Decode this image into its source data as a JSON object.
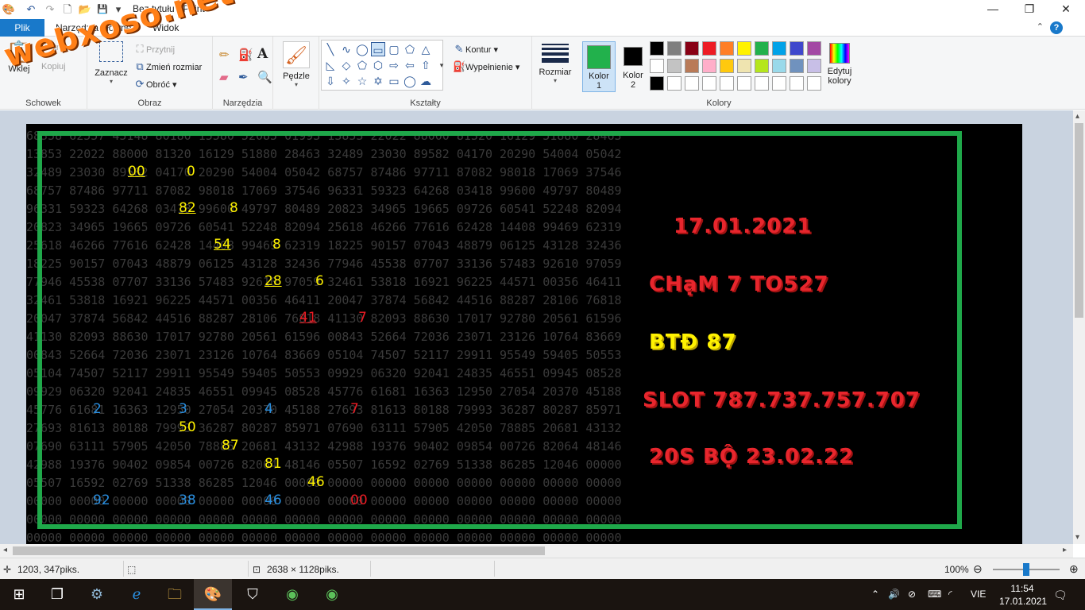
{
  "window": {
    "title": "Bez tytułu - Paint",
    "controls": {
      "minimize": "—",
      "maximize": "❐",
      "close": "✕"
    }
  },
  "quick_access": {
    "undo_icon": "↶",
    "redo_icon": "↷",
    "new_icon": "🗋",
    "save_icon": "💾",
    "dropdown": "▾"
  },
  "menu": {
    "file": "Plik",
    "tabs": [
      "Narzędzia główne",
      "Widok"
    ],
    "help": "?",
    "collapse": "⌃"
  },
  "ribbon": {
    "clipboard": {
      "label": "Schowek",
      "paste": "Wklej",
      "cut": "Wytnij",
      "copy": "Kopiuj"
    },
    "image": {
      "label": "Obraz",
      "select": "Zaznacz",
      "crop": "Przytnij",
      "resize": "Zmień rozmiar",
      "rotate": "Obróć"
    },
    "tools": {
      "label": "Narzędzia"
    },
    "brushes": {
      "label": "Pędzle"
    },
    "shapes": {
      "label": "Kształty",
      "outline": "Kontur",
      "fill": "Wypełnienie"
    },
    "size": {
      "label": "Rozmiar"
    },
    "colors": {
      "label": "Kolory",
      "color1": "Kolor 1",
      "color1_value": "#22b14c",
      "color2": "Kolor 2",
      "color2_value": "#000000",
      "edit": "Edytuj kolory",
      "palette": [
        "#000000",
        "#7f7f7f",
        "#880015",
        "#ed1c24",
        "#ff7f27",
        "#fff200",
        "#22b14c",
        "#00a2e8",
        "#3f48cc",
        "#a349a4",
        "#ffffff",
        "#c3c3c3",
        "#b97a57",
        "#ffaec9",
        "#ffc90e",
        "#efe4b0",
        "#b5e61d",
        "#99d9ea",
        "#7092be",
        "#c8bfe7",
        "#000000",
        "#ffffff",
        "#ffffff",
        "#ffffff",
        "#ffffff",
        "#ffffff",
        "#ffffff",
        "#ffffff",
        "#ffffff",
        "#ffffff"
      ]
    }
  },
  "watermark": "webxoso.net",
  "canvas": {
    "bg_rows": [
      "68358 62557 45148 80180 15580 52085 01993 13853 22022 88000 81320 16129 51880 28463",
      "13853 22022 88000 81320 16129 51880 28463 32489 23030 89582 04170 20290 54004 05042",
      "32489 23030 89582 04170 20290 54004 05042 68757 87486 97711 87082 98018 17069 37546",
      "68757 87486 97711 87082 98018 17069 37546 96331 59323 64268 03418 99600 49797 80489",
      "96331 59323 64268 03418 99600 49797 80489 20823 34965 19665 09726 60541 52248 82094",
      "20823 34965 19665 09726 60541 52248 82094 25618 46266 77616 62428 14408 99469 62319",
      "25618 46266 77616 62428 14408 99469 62319 18225 90157 07043 48879 06125 43128 32436",
      "18225 90157 07043 48879 06125 43128 32436 77946 45538 07707 33136 57483 92610 97059",
      "77946 45538 07707 33136 57483 92610 97059 32461 53818 16921 96225 44571 00356 46411",
      "32461 53818 16921 96225 44571 00356 46411 20047 37874 56842 44516 88287 28106 76818",
      "20047 37874 56842 44516 88287 28106 76818 41130 82093 88630 17017 92780 20561 61596",
      "41130 82093 88630 17017 92780 20561 61596 00843 52664 72036 23071 23126 10764 83669",
      "00843 52664 72036 23071 23126 10764 83669 05104 74507 52117 29911 95549 59405 50553",
      "05104 74507 52117 29911 95549 59405 50553 09929 06320 92041 24835 46551 09945 08528",
      "09929 06320 92041 24835 46551 09945 08528 45776 61681 16363 12950 27054 20370 45188",
      "45776 61681 16363 12950 27054 20370 45188 27693 81613 80188 79993 36287 80287 85971",
      "27693 81613 80188 79993 36287 80287 85971 07690 63111 57905 42050 78885 20681 43132",
      "07690 63111 57905 42050 78885 20681 43132 42988 19376 90402 09854 00726 82064 48146",
      "42988 19376 90402 09854 00726 82064 48146 05507 16592 02769 51338 86285 12046 00000",
      "05507 16592 02769 51338 86285 12046 00000 00000 00000 00000 00000 00000 00000 00000",
      "00000 00000 00000 00000 00000 00000 00000 00000 00000 00000 00000 00000 00000 00000",
      "00000 00000 00000 00000 00000 00000 00000 00000 00000 00000 00000 00000 00000 00000",
      "00000 00000 00000 00000 00000 00000 00000 00000 00000 00000 00000 00000 00000 00000"
    ],
    "highlights": [
      {
        "text": "00",
        "color": "#fff200",
        "underline": true
      },
      {
        "text": "0",
        "color": "#fff200",
        "underline": false
      },
      {
        "text": "82",
        "color": "#fff200",
        "underline": true
      },
      {
        "text": "8",
        "color": "#fff200",
        "underline": false
      },
      {
        "text": "54",
        "color": "#fff200",
        "underline": true
      },
      {
        "text": "8",
        "color": "#fff200",
        "underline": false
      },
      {
        "text": "28",
        "color": "#fff200",
        "underline": true
      },
      {
        "text": "6",
        "color": "#fff200",
        "underline": false
      },
      {
        "text": "41",
        "color": "#ed1c24",
        "underline": true
      },
      {
        "text": "7",
        "color": "#ed1c24",
        "underline": false
      },
      {
        "text": "2",
        "color": "#2a8fe0",
        "underline": false
      },
      {
        "text": "3",
        "color": "#2a8fe0",
        "underline": false
      },
      {
        "text": "4",
        "color": "#2a8fe0",
        "underline": false
      },
      {
        "text": "7",
        "color": "#ed1c24",
        "underline": false
      },
      {
        "text": "50",
        "color": "#fff200",
        "underline": false
      },
      {
        "text": "87",
        "color": "#fff200",
        "underline": false
      },
      {
        "text": "81",
        "color": "#fff200",
        "underline": false
      },
      {
        "text": "46",
        "color": "#fff200",
        "underline": false
      },
      {
        "text": "92",
        "color": "#2a8fe0",
        "underline": false
      },
      {
        "text": "38",
        "color": "#2a8fe0",
        "underline": false
      },
      {
        "text": "46",
        "color": "#2a8fe0",
        "underline": false
      },
      {
        "text": "00",
        "color": "#ed1c24",
        "underline": false
      }
    ],
    "date": "17.01.2021",
    "cham": "CHạM 7 TO527",
    "btd": "BTĐ 87",
    "slot": "SLOT 787.737.757.707",
    "bo": "20S BỘ 23.02.22"
  },
  "status": {
    "cursor": "1203, 347piks.",
    "size": "2638 × 1128piks.",
    "zoom": "100%",
    "zoom_level": 0.5
  },
  "taskbar": {
    "lang": "VIE",
    "time": "11:54",
    "date": "17.01.2021"
  }
}
